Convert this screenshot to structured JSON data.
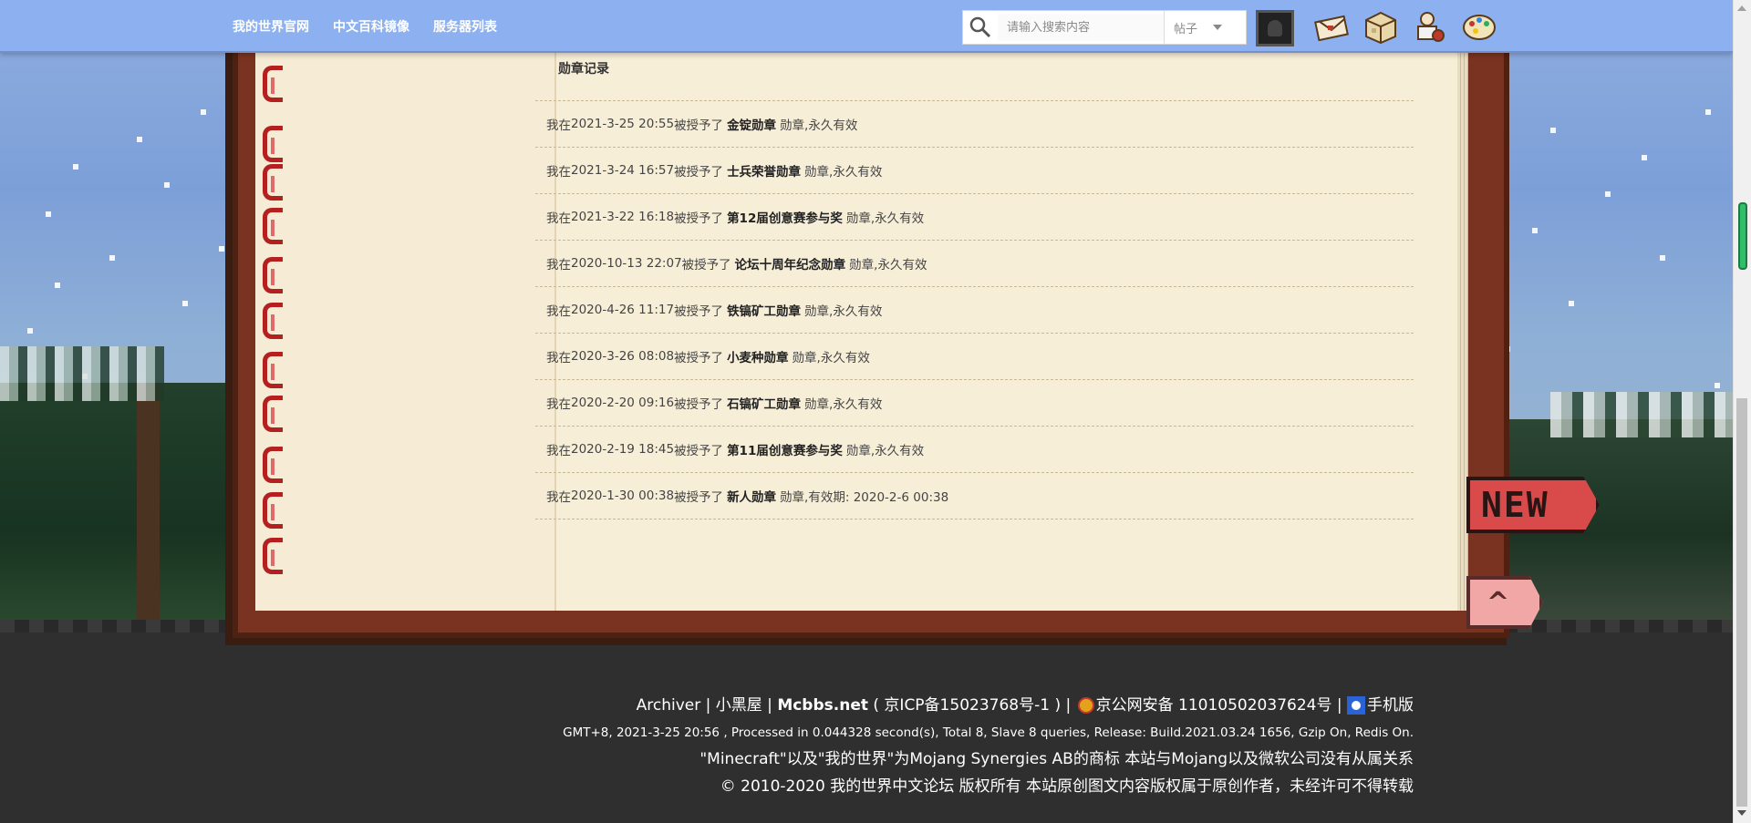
{
  "nav": {
    "links": [
      "我的世界官网",
      "中文百科镜像",
      "服务器列表"
    ],
    "search": {
      "placeholder": "请输入搜索内容",
      "type_selected": "帖子"
    },
    "icons": [
      "avatar",
      "envelope-icon",
      "gift-box-icon",
      "user-settings-icon",
      "palette-icon"
    ]
  },
  "medal_section": {
    "heading": "勋章记录",
    "entries": [
      {
        "prefix": "我在",
        "datetime": "2021-3-25 20:55",
        "verb": "被授予了",
        "medal": "金锭勋章",
        "suffix": "勋章,永久有效"
      },
      {
        "prefix": "我在",
        "datetime": "2021-3-24 16:57",
        "verb": "被授予了",
        "medal": "士兵荣誉勋章",
        "suffix": "勋章,永久有效"
      },
      {
        "prefix": "我在",
        "datetime": "2021-3-22 16:18",
        "verb": "被授予了",
        "medal": "第12届创意赛参与奖",
        "suffix": "勋章,永久有效"
      },
      {
        "prefix": "我在",
        "datetime": "2020-10-13 22:07",
        "verb": "被授予了",
        "medal": "论坛十周年纪念勋章",
        "suffix": "勋章,永久有效"
      },
      {
        "prefix": "我在",
        "datetime": "2020-4-26 11:17",
        "verb": "被授予了",
        "medal": "铁镐矿工勋章",
        "suffix": "勋章,永久有效"
      },
      {
        "prefix": "我在",
        "datetime": "2020-3-26 08:08",
        "verb": "被授予了",
        "medal": "小麦种勋章",
        "suffix": "勋章,永久有效"
      },
      {
        "prefix": "我在",
        "datetime": "2020-2-20 09:16",
        "verb": "被授予了",
        "medal": "石镐矿工勋章",
        "suffix": "勋章,永久有效"
      },
      {
        "prefix": "我在",
        "datetime": "2020-2-19 18:45",
        "verb": "被授予了",
        "medal": "第11届创意赛参与奖",
        "suffix": "勋章,永久有效"
      },
      {
        "prefix": "我在",
        "datetime": "2020-1-30 00:38",
        "verb": "被授予了",
        "medal": "新人勋章",
        "suffix": "勋章,有效期: 2020-2-6 00:38"
      }
    ]
  },
  "badges": {
    "new_label": "NEW",
    "top_label": "^"
  },
  "footer": {
    "archiver": "Archiver",
    "sep1": "|",
    "blackroom": "小黑屋",
    "sep2": "|",
    "site": "Mcbbs.net",
    "icp": "( 京ICP备15023768号-1 )",
    "sep3": "|",
    "police": "京公网安备 11010502037624号",
    "sep4": "|",
    "mobile": "手机版",
    "stats": "GMT+8, 2021-3-25 20:56 , Processed in 0.044328 second(s), Total 8, Slave 8 queries, Release: Build.2021.03.24 1656, Gzip On, Redis On.",
    "trademark": "\"Minecraft\"以及\"我的世界\"为Mojang Synergies AB的商标 本站与Mojang以及微软公司没有从属关系",
    "copyright": "© 2010-2020 我的世界中文论坛 版权所有 本站原创图文内容版权属于原创作者，未经许可不得转载"
  },
  "colors": {
    "navbar": "#8cb0f0",
    "page": "#f7eed8",
    "book_cover": "#7a3320",
    "binding_ring": "#b41f1f",
    "footer_bg": "#2f2f2f"
  }
}
